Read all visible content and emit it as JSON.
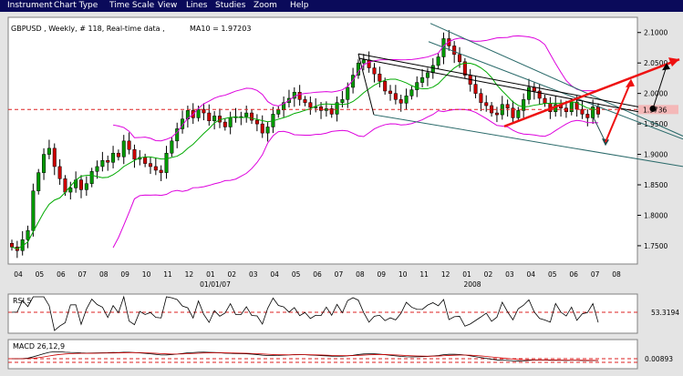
{
  "menu": [
    "Instrument",
    "Chart Type",
    "Time Scale",
    "View",
    "Lines",
    "Studies",
    "Zoom",
    "Help"
  ],
  "chart_data": [
    {
      "type": "candlestick",
      "header": {
        "symbol_line": "GBPUSD , Weekly, # 118, Real-time data ,",
        "ma_label": "MA10 = 1.97203"
      },
      "ylim": [
        1.72,
        2.125
      ],
      "y_ticks": [
        "2.1000",
        "2.0500",
        "2.0000",
        "1.9500",
        "1.9000",
        "1.8500",
        "1.8000",
        "1.7500"
      ],
      "x_ticks": [
        "04",
        "05",
        "06",
        "07",
        "08",
        "09",
        "10",
        "11",
        "12",
        "01",
        "02",
        "03",
        "04",
        "05",
        "06",
        "07",
        "08",
        "09",
        "10",
        "11",
        "12",
        "01",
        "02",
        "03",
        "04",
        "05",
        "06",
        "07",
        "08"
      ],
      "x_year_labels": [
        "01/01/07",
        "2008"
      ],
      "price_marker": "1.9736",
      "horizontal_line": 1.9736,
      "close": [
        1.748,
        1.742,
        1.76,
        1.775,
        1.84,
        1.87,
        1.9,
        1.91,
        1.88,
        1.86,
        1.838,
        1.845,
        1.858,
        1.842,
        1.852,
        1.872,
        1.88,
        1.89,
        1.887,
        1.902,
        1.896,
        1.922,
        1.908,
        1.892,
        1.895,
        1.885,
        1.88,
        1.874,
        1.87,
        1.902,
        1.922,
        1.942,
        1.958,
        1.972,
        1.96,
        1.974,
        1.968,
        1.955,
        1.963,
        1.953,
        1.945,
        1.96,
        1.962,
        1.962,
        1.968,
        1.956,
        1.95,
        1.935,
        1.945,
        1.966,
        1.973,
        1.985,
        1.992,
        2.002,
        1.99,
        1.985,
        1.977,
        1.978,
        1.972,
        1.975,
        1.966,
        1.985,
        1.99,
        2.01,
        2.03,
        2.05,
        2.055,
        2.042,
        2.032,
        2.02,
        2.004,
        2.0,
        1.99,
        1.984,
        1.996,
        2.006,
        2.018,
        2.026,
        2.034,
        2.046,
        2.06,
        2.09,
        2.078,
        2.064,
        2.052,
        2.03,
        2.015,
        2.0,
        1.985,
        1.98,
        1.968,
        1.965,
        1.982,
        1.976,
        1.96,
        1.972,
        1.99,
        2.01,
        2.004,
        1.992,
        1.984,
        1.97,
        1.982,
        1.976,
        1.97,
        1.986,
        1.974,
        1.966,
        1.96,
        1.978,
        1.966
      ],
      "overlays": {
        "ma10_value": 1.97203,
        "bollinger_bands": true
      },
      "indicators": [
        {
          "name": "RSI 5",
          "label": "RSI 5",
          "level": "53.3194"
        },
        {
          "name": "MACD 26,12,9",
          "label": "MACD 26,12,9",
          "level": "0.00893"
        }
      ]
    }
  ]
}
